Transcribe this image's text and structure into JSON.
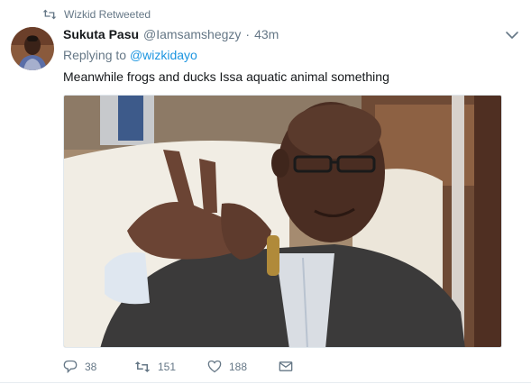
{
  "retweet_context": {
    "icon": "retweet-icon",
    "text": "Wizkid Retweeted"
  },
  "author": {
    "display_name": "Sukuta Pasu",
    "handle": "@Iamsamshegzy",
    "separator": "·",
    "timestamp": "43m",
    "avatar": "avatar-photo"
  },
  "reply": {
    "prefix": "Replying to",
    "target": "@wizkidayo"
  },
  "tweet_text": "Meanwhile frogs and ducks Issa aquatic animal something",
  "media": {
    "type": "photo"
  },
  "actions": {
    "replies": {
      "icon": "reply-icon",
      "count": "38"
    },
    "retweets": {
      "icon": "retweet-icon",
      "count": "151"
    },
    "likes": {
      "icon": "heart-icon",
      "count": "188"
    },
    "dm": {
      "icon": "envelope-icon"
    }
  },
  "colors": {
    "link": "#1b95e0",
    "secondary_text": "#657786",
    "primary_text": "#14171a"
  }
}
